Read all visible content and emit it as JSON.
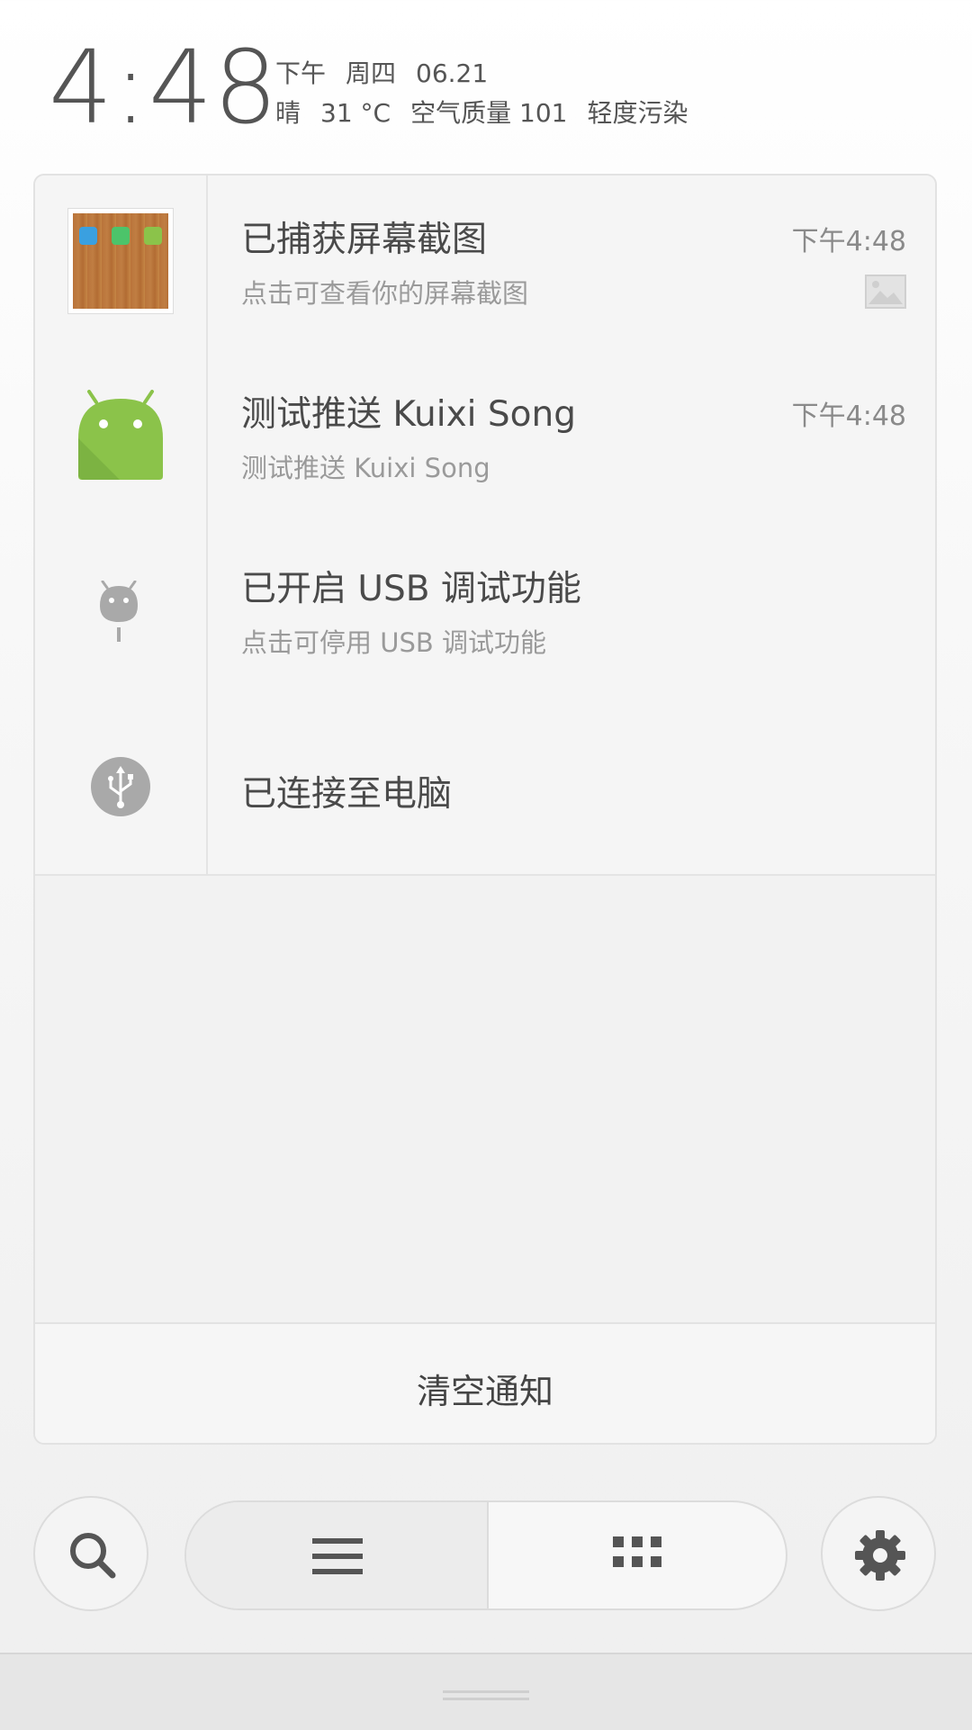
{
  "header": {
    "time": "4:48",
    "period": "下午",
    "weekday": "周四",
    "date": "06.21",
    "weather": "晴",
    "temperature": "31 °C",
    "air_quality": "空气质量 101",
    "pollution": "轻度污染"
  },
  "notifications": [
    {
      "title": "已捕获屏幕截图",
      "subtitle": "点击可查看你的屏幕截图",
      "time": "下午4:48",
      "icon": "screenshot-thumbnail"
    },
    {
      "title": "测试推送 Kuixi Song",
      "subtitle": "测试推送 Kuixi Song",
      "time": "下午4:48",
      "icon": "android-icon"
    },
    {
      "title": "已开启 USB 调试功能",
      "subtitle": "点击可停用 USB 调试功能",
      "icon": "usb-debug-icon"
    },
    {
      "title": "已连接至电脑",
      "icon": "usb-icon"
    }
  ],
  "clear_button": {
    "label": "清空通知"
  },
  "controls": {
    "search_icon": "search-icon",
    "menu_icon": "menu-icon",
    "grid_icon": "grid-icon",
    "settings_icon": "gear-icon"
  },
  "colors": {
    "android_green": "#8bc34a",
    "icon_gray": "#a9a9a9",
    "text_dark": "#4a4a4a",
    "text_light": "#9a9a9a"
  }
}
